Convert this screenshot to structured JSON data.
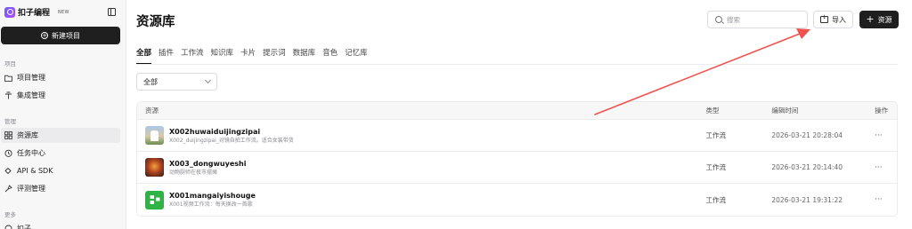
{
  "sidebar": {
    "brand": "扣子编程",
    "brand_tag": "NEW",
    "new_project": "新建项目",
    "section_project": "项目",
    "project_items": [
      {
        "label": "项目管理",
        "icon": "folder-icon"
      },
      {
        "label": "集成管理",
        "icon": "integration-icon"
      }
    ],
    "section_manage": "管理",
    "manage_items": [
      {
        "label": "资源库",
        "icon": "library-icon"
      },
      {
        "label": "任务中心",
        "icon": "clock-icon"
      },
      {
        "label": "API & SDK",
        "icon": "api-icon"
      },
      {
        "label": "评测管理",
        "icon": "eval-icon"
      }
    ],
    "section_more": "更多",
    "more_items": [
      {
        "label": "扣子",
        "icon": "coze-icon"
      }
    ]
  },
  "header": {
    "title": "资源库",
    "search_placeholder": "搜索",
    "import_label": "导入",
    "add_label": "资源"
  },
  "tabs": [
    "全部",
    "插件",
    "工作流",
    "知识库",
    "卡片",
    "提示词",
    "数据库",
    "音色",
    "记忆库"
  ],
  "filter": {
    "selected": "全部"
  },
  "table": {
    "columns": [
      "资源",
      "类型",
      "编辑时间",
      "操作"
    ],
    "rows": [
      {
        "name": "X002huwaiduijingzipai",
        "desc": "X002_duijingzipai_对镜自拍工作流。适合女装带货",
        "type": "工作流",
        "time": "2026-03-21 20:28:04",
        "op": "···"
      },
      {
        "name": "X003_dongwuyeshi",
        "desc": "动物厨师在夜市摆摊",
        "type": "工作流",
        "time": "2026-03-21 20:14:40",
        "op": "···"
      },
      {
        "name": "X001mangaiyishouge",
        "desc": "X001视频工作流：每天换改一首歌",
        "type": "工作流",
        "time": "2026-03-21 19:31:22",
        "op": "···"
      }
    ]
  },
  "colors": {
    "primary": "#1f1f1f",
    "annotation_arrow": "#ef5350",
    "active_nav": "#ebebee"
  }
}
